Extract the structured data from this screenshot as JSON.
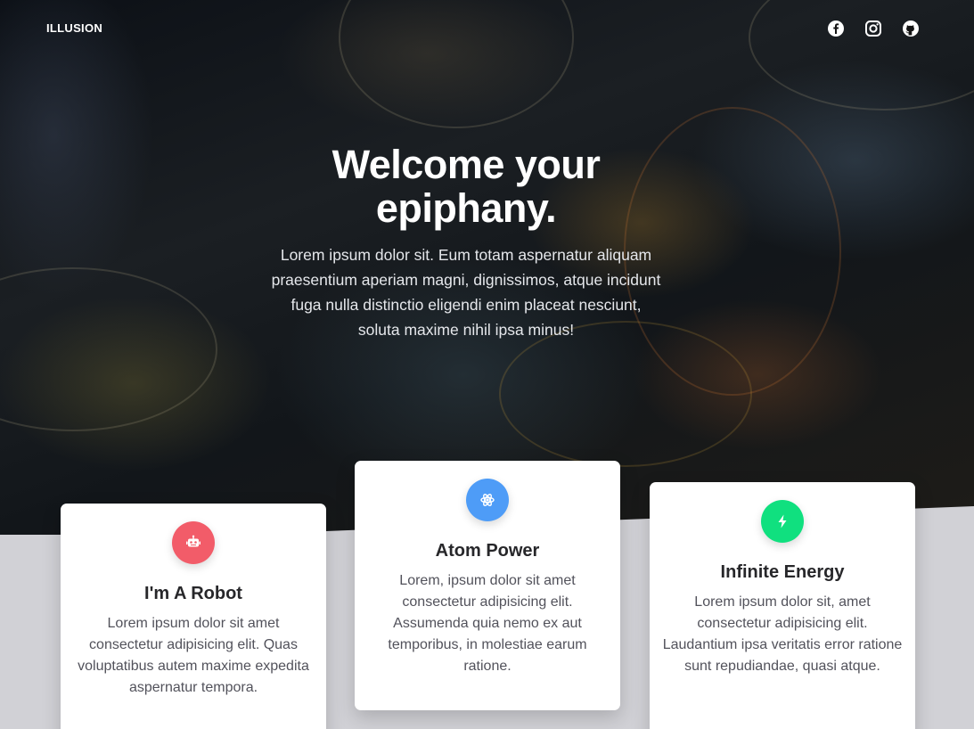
{
  "brand": "ILLUSION",
  "nav": {
    "social": [
      {
        "icon": "facebook-icon"
      },
      {
        "icon": "instagram-icon"
      },
      {
        "icon": "github-icon"
      }
    ]
  },
  "hero": {
    "title_line1": "Welcome your",
    "title_line2": "epiphany.",
    "text": "Lorem ipsum dolor sit. Eum totam aspernatur aliquam praesentium aperiam magni, dignissimos, atque incidunt fuga nulla distinctio eligendi enim placeat nesciunt, soluta maxime nihil ipsa minus!"
  },
  "cards": [
    {
      "icon": "robot-icon",
      "color": "#f25c69",
      "title": "I'm A Robot",
      "text": "Lorem ipsum dolor sit amet consectetur adipisicing elit. Quas voluptatibus autem maxime expedita aspernatur tempora."
    },
    {
      "icon": "atom-icon",
      "color": "#4e9cf7",
      "title": "Atom Power",
      "text": "Lorem, ipsum dolor sit amet consectetur adipisicing elit. Assumenda quia nemo ex aut temporibus, in molestiae earum ratione."
    },
    {
      "icon": "bolt-icon",
      "color": "#10e07f",
      "title": "Infinite Energy",
      "text": "Lorem ipsum dolor sit, amet consectetur adipisicing elit. Laudantium ipsa veritatis error ratione sunt repudiandae, quasi atque."
    }
  ]
}
